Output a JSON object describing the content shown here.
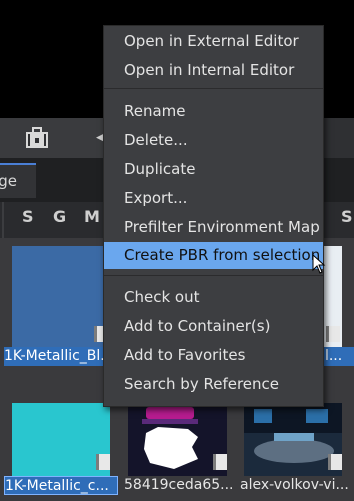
{
  "tab": {
    "label": "age"
  },
  "filters": [
    "S",
    "G",
    "M",
    "S"
  ],
  "toolbar": {
    "arrow": "◀"
  },
  "thumbnails": [
    {
      "label": "1K-Metallic_Bl...",
      "selected": true,
      "color": "#3b6aa5"
    },
    {
      "label": "...Bl...",
      "selected": true,
      "color": "#e9eef3"
    },
    {
      "label": "1K-Metallic_c...",
      "selected": true,
      "color": "#29c6cf"
    },
    {
      "label": "58419ceda65...",
      "selected": false,
      "color": "#14142a"
    },
    {
      "label": "alex-volkov-vi...",
      "selected": false,
      "color": "#1b2a3c"
    }
  ],
  "menu": {
    "group1": [
      "Open in External Editor",
      "Open in Internal Editor"
    ],
    "group2": [
      "Rename",
      "Delete...",
      "Duplicate",
      "Export...",
      "Prefilter Environment Map",
      "Create PBR from selection"
    ],
    "group3": [
      "Check out",
      "Add to Container(s)",
      "Add to Favorites",
      "Search by Reference"
    ],
    "highlighted": "Create PBR from selection"
  },
  "colors": {
    "highlight": "#6aa7ee",
    "selection": "#2f6db8",
    "accent_tab": "#4a7fd6"
  }
}
